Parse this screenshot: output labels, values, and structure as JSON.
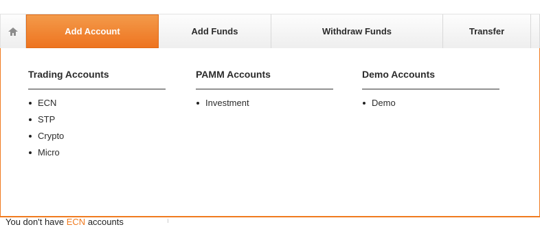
{
  "nav": {
    "home_icon": "home-icon",
    "tabs": [
      {
        "label": "Add Account",
        "active": true
      },
      {
        "label": "Add Funds",
        "active": false
      },
      {
        "label": "Withdraw Funds",
        "active": false
      },
      {
        "label": "Transfer",
        "active": false
      }
    ]
  },
  "menu": {
    "trading": {
      "title": "Trading Accounts",
      "items": [
        "ECN",
        "STP",
        "Crypto",
        "Micro"
      ]
    },
    "pamm": {
      "title": "PAMM Accounts",
      "items": [
        "Investment"
      ]
    },
    "demo": {
      "title": "Demo Accounts",
      "items": [
        "Demo"
      ]
    }
  },
  "notice": {
    "prefix": "You don't have ",
    "link": "ECN",
    "suffix": " accounts"
  },
  "colors": {
    "accent": "#f07a1e",
    "text": "#2b2b2b"
  }
}
